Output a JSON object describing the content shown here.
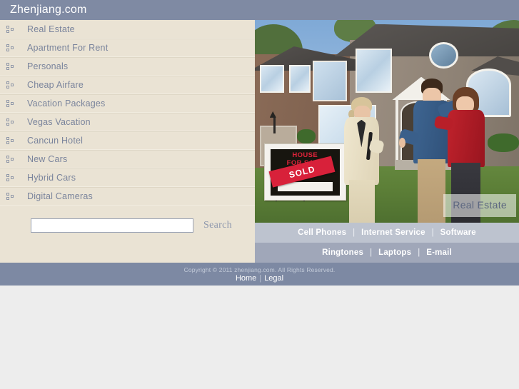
{
  "header": {
    "site_title": "Zhenjiang.com",
    "background_color": "#7f8aa3"
  },
  "sidebar": {
    "background_color": "#eae3d4",
    "bullet_icon": "square-bullet-icon",
    "items": [
      {
        "label": "Real Estate"
      },
      {
        "label": "Apartment For Rent"
      },
      {
        "label": "Personals"
      },
      {
        "label": "Cheap Airfare"
      },
      {
        "label": "Vacation Packages"
      },
      {
        "label": "Vegas Vacation"
      },
      {
        "label": "Cancun Hotel"
      },
      {
        "label": "New Cars"
      },
      {
        "label": "Hybrid Cars"
      },
      {
        "label": "Digital Cameras"
      }
    ]
  },
  "search": {
    "value": "",
    "placeholder": "",
    "button_label": "Search"
  },
  "hero": {
    "caption": "Real Estate",
    "alt": "real-estate-agent-handshake-with-couple-in-front-of-house",
    "sign": {
      "line1": "HOUSE",
      "line2": "FOR SALE",
      "stamp": "SOLD",
      "stamp_color": "#d8213a",
      "board_color": "#17150f"
    }
  },
  "link_bars": [
    {
      "background_color": "#bdc3cf",
      "separator": "|",
      "links": [
        {
          "label": "Cell Phones"
        },
        {
          "label": "Internet Service"
        },
        {
          "label": "Software"
        }
      ]
    },
    {
      "background_color": "#a0a7b9",
      "separator": "|",
      "links": [
        {
          "label": "Ringtones"
        },
        {
          "label": "Laptops"
        },
        {
          "label": "E-mail"
        }
      ]
    }
  ],
  "footer": {
    "background_color": "#7d89a3",
    "copyright": "Copyright © 2011 zhenjiang.com. All Rights Reserved.",
    "separator": "|",
    "links": [
      {
        "label": "Home"
      },
      {
        "label": "Legal"
      }
    ]
  },
  "page": {
    "body_background": "#ededed"
  }
}
